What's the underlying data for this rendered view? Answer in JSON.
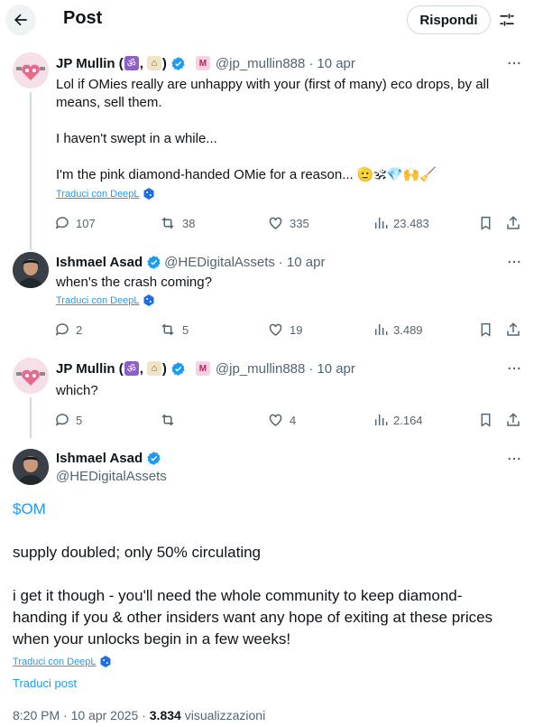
{
  "header": {
    "title": "Post",
    "reply_label": "Rispondi"
  },
  "tweets": [
    {
      "name": "JP Mullin (",
      "name_sep": ",",
      "name_end": ")",
      "badges": [
        "om-symbol",
        "house-with-garden"
      ],
      "handle": "@jp_mullin888",
      "date": "10 apr",
      "lines": [
        "Lol if OMies really are unhappy with your (first of many) eco drops, by all",
        "means, sell them.",
        "",
        "I haven't swept in a while...",
        "",
        "I'm the pink diamond-handed OMie for a reason... 🫡🕉💎🙌🧹"
      ],
      "translate": "Traduci con DeepL",
      "replies": "107",
      "reposts": "38",
      "likes": "335",
      "views": "23.483"
    },
    {
      "name": "Ishmael Asad",
      "handle": "@HEDigitalAssets",
      "date": "10 apr",
      "lines": [
        "when's the crash coming?"
      ],
      "translate": "Traduci con DeepL",
      "replies": "2",
      "reposts": "5",
      "likes": "19",
      "views": "3.489"
    },
    {
      "name": "JP Mullin (",
      "name_sep": ",",
      "name_end": ")",
      "handle": "@jp_mullin888",
      "date": "10 apr",
      "lines": [
        "which?"
      ],
      "replies": "5",
      "reposts": "",
      "likes": "4",
      "views": "2.164"
    }
  ],
  "main": {
    "name": "Ishmael Asad",
    "handle": "@HEDigitalAssets",
    "cashtag": "$OM",
    "line1": "supply doubled; only 50% circulating",
    "line2a": "i get it though - you'll need the whole community to keep diamond-",
    "line2b": "handing if you & other insiders want any hope of exiting at these prices",
    "line2c": "when your unlocks begin in a few weeks!",
    "translate": "Traduci con DeepL",
    "translate_post": "Traduci post",
    "time": "8:20 PM · 10 apr 2025 · ",
    "views_count": "3.834",
    "views_label": " visualizzazioni"
  },
  "colors": {
    "accent": "#1d9bf0",
    "secondary_text": "#536471",
    "border": "#cfd9de"
  },
  "icons": [
    "back-arrow-icon",
    "filter-icon",
    "more-icon",
    "reply-icon",
    "repost-icon",
    "like-icon",
    "views-icon",
    "bookmark-icon",
    "share-icon",
    "verified-icon",
    "deepl-icon"
  ]
}
